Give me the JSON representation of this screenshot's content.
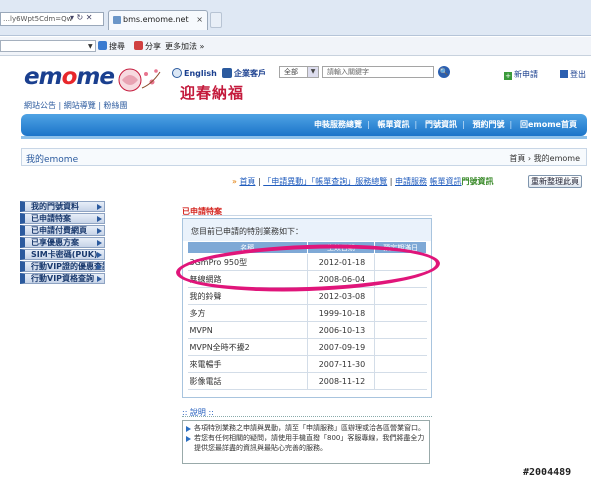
{
  "browser": {
    "address_text": "…ly6Wpt5Cdm=Qw",
    "nav_symbols": "▾ ↻ ✕",
    "tab_title": "bms.emome.net",
    "tab_close": "×",
    "toolbar": {
      "search_label": "搜尋",
      "share_label": "分享",
      "more_label": "更多加法 »"
    }
  },
  "header": {
    "logo_text": [
      "em",
      "o",
      "me"
    ],
    "festive_text": "迎春納福",
    "top_links": "網站公告 | 網站導覽 | 粉絲團",
    "english_label": "English",
    "enterprise_label": "企業客戶",
    "search_scope": "全部",
    "search_placeholder": "請輸入關鍵字",
    "new_app_label": "新申請",
    "logout_label": "登出"
  },
  "navbar": {
    "items": [
      "申裝服務總覽",
      "帳單資訊",
      "門號資訊",
      "預約門號",
      "回emome首頁"
    ]
  },
  "titlebar": {
    "title": "我的emome",
    "crumb": "首頁 › 我的emome"
  },
  "breadcrumb": {
    "lead": "» ",
    "home": "首頁",
    "sep": " | ",
    "link1": "「申請異動」「帳單查詢」服務總覽",
    "link2": "申請服務",
    "link3": "帳單資訊",
    "current": "門號資訊",
    "refresh_label": "重新整理此頁"
  },
  "sidebar": {
    "items": [
      "我的門號資料",
      "已申請特案",
      "已申請付費網頁",
      "已享優惠方案",
      "SIM卡密碼(PUK)",
      "行動VIP證的優惠查詢",
      "行動VIP資格查詢"
    ]
  },
  "main": {
    "section_title": "已申請特案",
    "caption": "您目前已申請的特別業務如下：",
    "columns": [
      "名稱",
      "生效日期",
      "預定期滿日"
    ],
    "rows": [
      [
        "3GmPro 950型",
        "2012-01-18",
        ""
      ],
      [
        "無線網路",
        "2008-06-04",
        ""
      ],
      [
        "我的鈴聲",
        "2012-03-08",
        ""
      ],
      [
        "多方",
        "1999-10-18",
        ""
      ],
      [
        "MVPN",
        "2006-10-13",
        ""
      ],
      [
        "MVPN全時不擾2",
        "2007-09-19",
        ""
      ],
      [
        "來電暢手",
        "2007-11-30",
        ""
      ],
      [
        "影像電話",
        "2008-11-12",
        ""
      ]
    ]
  },
  "notes": {
    "title": ":: 說明 ::",
    "lines": [
      "各項特別業務之申請與異動，請至「申請服務」區辦理或洽各區營業窗口。",
      "若您有任何相關的疑問，請使用手機直撥「800」客服專線，我們將盡全力提供您最詳盡的資訊與最貼心完善的服務。"
    ]
  },
  "watermark": "#2004489",
  "colors": {
    "nav_blue": "#1b74c9",
    "section_red": "#d4251f",
    "highlight_oval": "#e0157a",
    "header_blue": "#7fa9d6"
  }
}
